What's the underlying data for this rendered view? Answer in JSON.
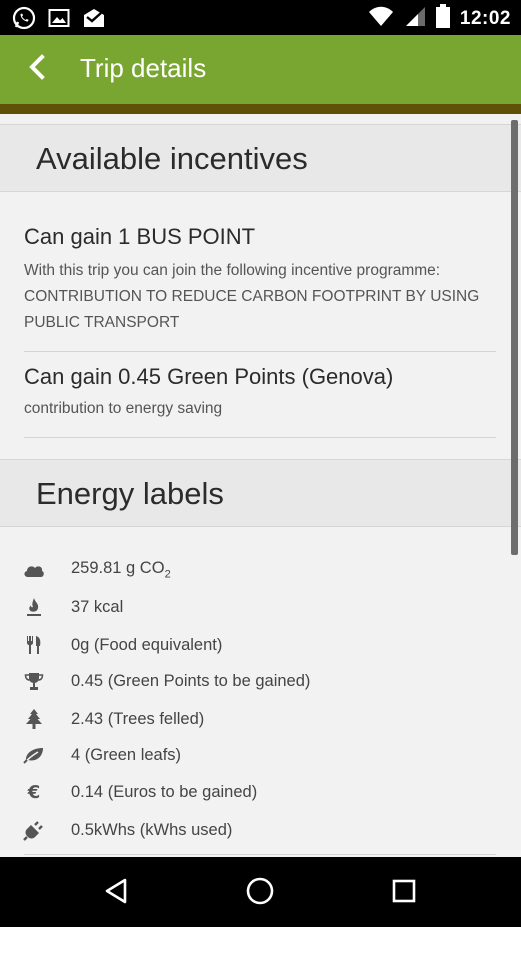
{
  "status_bar": {
    "time": "12:02",
    "left_icons": [
      "whatsapp-icon",
      "gallery-icon",
      "inbox-icon"
    ],
    "right_icons": [
      "wifi-icon",
      "signal-icon",
      "battery-icon"
    ]
  },
  "app_bar": {
    "title": "Trip details",
    "back_icon": "chevron-left-icon",
    "color": "#79a631"
  },
  "incentives": {
    "title": "Available incentives",
    "items": [
      {
        "heading": "Can gain 1 BUS POINT",
        "description": "With this trip you can join the following incentive programme: CONTRIBUTION TO REDUCE CARBON FOOTPRINT BY USING PUBLIC TRANSPORT"
      },
      {
        "heading": "Can gain 0.45 Green Points (Genova)",
        "description": "contribution to energy saving"
      }
    ]
  },
  "energy_labels": {
    "title": "Energy labels",
    "co2": {
      "value": "259.81 g CO",
      "sub": "2",
      "icon": "cloud-icon"
    },
    "items": [
      {
        "text": "37 kcal",
        "icon": "flame-icon"
      },
      {
        "text": "0g (Food equivalent)",
        "icon": "cutlery-icon"
      },
      {
        "text": "0.45 (Green Points to be gained)",
        "icon": "trophy-icon"
      },
      {
        "text": "2.43 (Trees felled)",
        "icon": "tree-icon"
      },
      {
        "text": "4 (Green leafs)",
        "icon": "leaf-icon"
      },
      {
        "text": "0.14 (Euros to be gained)",
        "icon": "euro-icon"
      },
      {
        "text": "0.5kWhs (kWhs used)",
        "icon": "plug-icon"
      }
    ]
  },
  "nav_bar": {
    "back": "back-triangle-icon",
    "home": "home-circle-icon",
    "recents": "recents-square-icon"
  }
}
